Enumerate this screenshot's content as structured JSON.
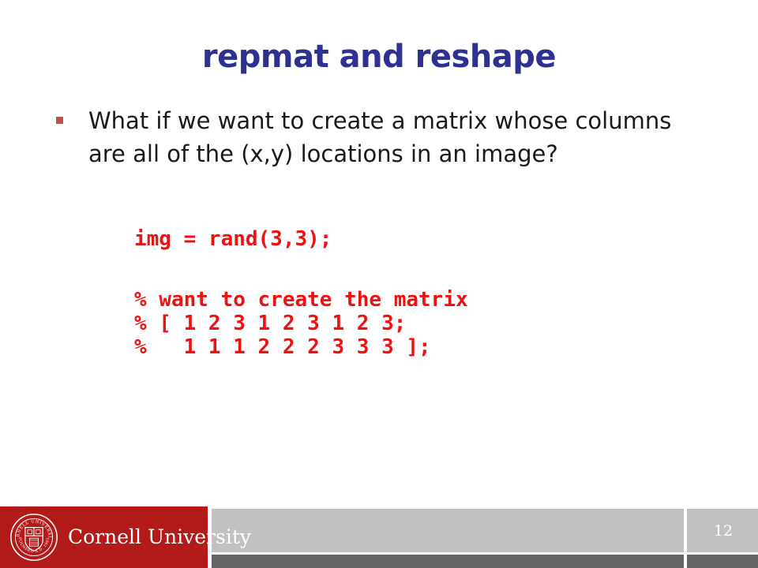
{
  "slide": {
    "title": "repmat and reshape",
    "page_number": "12",
    "accent_title_color": "#2e3192",
    "code_color": "#ee1111",
    "bullet_marker_color": "#c0504d",
    "brand_color": "#b31b1b",
    "footer_light_band_color": "#c1c1c1",
    "footer_dark_band_color": "#666666"
  },
  "body": {
    "bullets": [
      {
        "text": "What if we want to create a matrix whose columns are all of the (x,y) locations in an image?"
      }
    ]
  },
  "code": {
    "lines": [
      "img = rand(3,3);",
      "",
      "% want to create the matrix",
      "% [ 1 2 3 1 2 3 1 2 3;",
      "%   1 1 1 2 2 2 3 3 3 ];"
    ]
  },
  "footer": {
    "institution": "Cornell University",
    "seal_outer_text": "CORNELL UNIVERSITY",
    "seal_founded_text": "FOUNDED A.D. 1865"
  }
}
